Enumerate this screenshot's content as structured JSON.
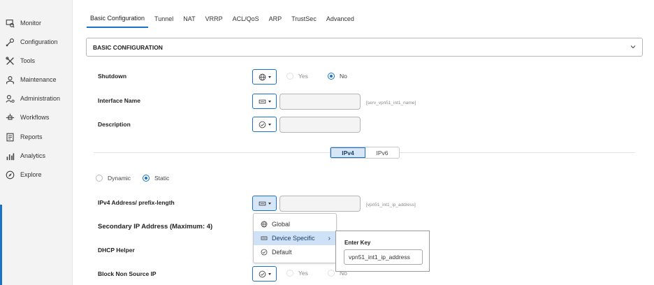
{
  "sidebar": {
    "items": [
      {
        "label": "Monitor",
        "icon": "monitor-icon"
      },
      {
        "label": "Configuration",
        "icon": "configuration-icon"
      },
      {
        "label": "Tools",
        "icon": "tools-icon"
      },
      {
        "label": "Maintenance",
        "icon": "maintenance-icon"
      },
      {
        "label": "Administration",
        "icon": "administration-icon"
      },
      {
        "label": "Workflows",
        "icon": "workflows-icon"
      },
      {
        "label": "Reports",
        "icon": "reports-icon"
      },
      {
        "label": "Analytics",
        "icon": "analytics-icon"
      },
      {
        "label": "Explore",
        "icon": "explore-icon"
      }
    ],
    "accent_color": "#1a73c7"
  },
  "tabs": [
    {
      "label": "Basic Configuration",
      "active": true
    },
    {
      "label": "Tunnel"
    },
    {
      "label": "NAT"
    },
    {
      "label": "VRRP"
    },
    {
      "label": "ACL/QoS"
    },
    {
      "label": "ARP"
    },
    {
      "label": "TrustSec"
    },
    {
      "label": "Advanced"
    }
  ],
  "section": {
    "title": "BASIC CONFIGURATION"
  },
  "form": {
    "shutdown": {
      "label": "Shutdown",
      "yes": "Yes",
      "no": "No",
      "selected": "No",
      "scope_icon": "globe-icon"
    },
    "interface_name": {
      "label": "Interface Name",
      "value": "",
      "hint": "[serv_vpn51_int1_name]",
      "scope_icon": "device-icon"
    },
    "description": {
      "label": "Description",
      "value": "",
      "scope_icon": "default-check-icon"
    },
    "ip_version": {
      "options": [
        "IPv4",
        "IPv6"
      ],
      "selected": "IPv4"
    },
    "addressing": {
      "dynamic": "Dynamic",
      "static": "Static",
      "selected": "Static"
    },
    "ipv4_address": {
      "label": "IPv4 Address/ prefix-length",
      "value": "",
      "hint": "[vpn51_int1_ip_address]",
      "scope_icon": "device-icon"
    },
    "secondary_ip": {
      "label": "Secondary IP Address (Maximum: 4)"
    },
    "dhcp_helper": {
      "label": "DHCP Helper"
    },
    "block_non_source_ip": {
      "label": "Block Non Source IP",
      "yes": "Yes",
      "no": "No",
      "scope_icon": "default-check-icon"
    }
  },
  "scope_menu": {
    "items": [
      {
        "label": "Global",
        "icon": "globe-icon"
      },
      {
        "label": "Device Specific",
        "icon": "device-icon",
        "highlighted": true
      },
      {
        "label": "Default",
        "icon": "default-check-icon"
      }
    ],
    "flyout": {
      "title": "Enter Key",
      "value": "vpn51_int1_ip_address"
    }
  }
}
